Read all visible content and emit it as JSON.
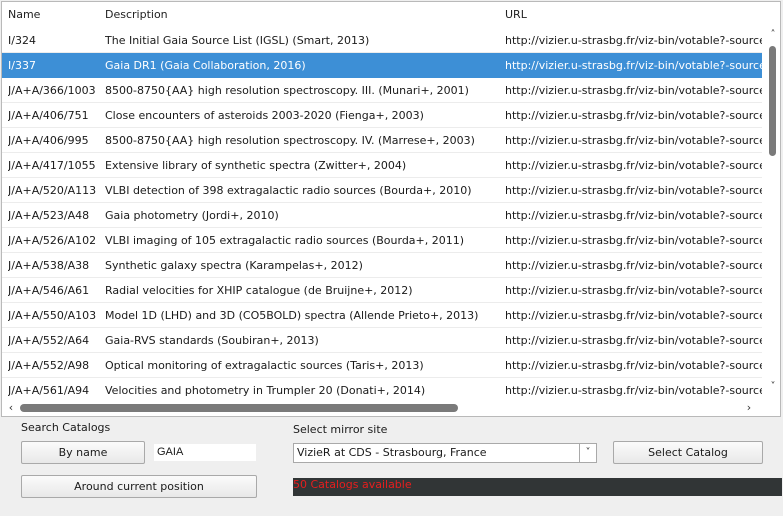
{
  "table": {
    "columns": {
      "name": "Name",
      "description": "Description",
      "url": "URL"
    },
    "rows": [
      {
        "name": "I/324",
        "description": "The Initial Gaia Source List (IGSL) (Smart, 2013)",
        "url": "http://vizier.u-strasbg.fr/viz-bin/votable?-source",
        "selected": false
      },
      {
        "name": "I/337",
        "description": "Gaia DR1 (Gaia Collaboration, 2016)",
        "url": "http://vizier.u-strasbg.fr/viz-bin/votable?-source",
        "selected": true
      },
      {
        "name": "J/A+A/366/1003",
        "description": "8500-8750{AA} high resolution spectroscopy. III. (Munari+, 2001)",
        "url": "http://vizier.u-strasbg.fr/viz-bin/votable?-source",
        "selected": false
      },
      {
        "name": "J/A+A/406/751",
        "description": "Close encounters of asteroids 2003-2020 (Fienga+, 2003)",
        "url": "http://vizier.u-strasbg.fr/viz-bin/votable?-source",
        "selected": false
      },
      {
        "name": "J/A+A/406/995",
        "description": "8500-8750{AA} high resolution spectroscopy. IV. (Marrese+, 2003)",
        "url": "http://vizier.u-strasbg.fr/viz-bin/votable?-source",
        "selected": false
      },
      {
        "name": "J/A+A/417/1055",
        "description": "Extensive library of synthetic spectra (Zwitter+, 2004)",
        "url": "http://vizier.u-strasbg.fr/viz-bin/votable?-source",
        "selected": false
      },
      {
        "name": "J/A+A/520/A113",
        "description": "VLBI detection of 398 extragalactic radio sources (Bourda+, 2010)",
        "url": "http://vizier.u-strasbg.fr/viz-bin/votable?-source",
        "selected": false
      },
      {
        "name": "J/A+A/523/A48",
        "description": "Gaia photometry (Jordi+, 2010)",
        "url": "http://vizier.u-strasbg.fr/viz-bin/votable?-source",
        "selected": false
      },
      {
        "name": "J/A+A/526/A102",
        "description": "VLBI imaging of 105 extragalactic radio sources (Bourda+, 2011)",
        "url": "http://vizier.u-strasbg.fr/viz-bin/votable?-source",
        "selected": false
      },
      {
        "name": "J/A+A/538/A38",
        "description": "Synthetic galaxy spectra (Karampelas+, 2012)",
        "url": "http://vizier.u-strasbg.fr/viz-bin/votable?-source",
        "selected": false
      },
      {
        "name": "J/A+A/546/A61",
        "description": "Radial velocities for XHIP catalogue (de Bruijne+, 2012)",
        "url": "http://vizier.u-strasbg.fr/viz-bin/votable?-source",
        "selected": false
      },
      {
        "name": "J/A+A/550/A103",
        "description": "Model 1D (LHD) and 3D (CO5BOLD) spectra (Allende Prieto+, 2013)",
        "url": "http://vizier.u-strasbg.fr/viz-bin/votable?-source",
        "selected": false
      },
      {
        "name": "J/A+A/552/A64",
        "description": "Gaia-RVS standards (Soubiran+, 2013)",
        "url": "http://vizier.u-strasbg.fr/viz-bin/votable?-source",
        "selected": false
      },
      {
        "name": "J/A+A/552/A98",
        "description": "Optical monitoring of extragalactic sources (Taris+, 2013)",
        "url": "http://vizier.u-strasbg.fr/viz-bin/votable?-source",
        "selected": false
      },
      {
        "name": "J/A+A/561/A94",
        "description": "Velocities and photometry in Trumpler 20 (Donati+, 2014)",
        "url": "http://vizier.u-strasbg.fr/viz-bin/votable?-source",
        "selected": false
      }
    ],
    "selected_color": "#3d8fd6"
  },
  "scrollbars": {
    "up_icon": "chevron-up-icon",
    "down_icon": "chevron-down-icon",
    "left_icon": "chevron-left-icon",
    "right_icon": "chevron-right-icon"
  },
  "search": {
    "label": "Search Catalogs",
    "by_name_button": "By name",
    "query_value": "GAIA",
    "around_position_button": "Around current position"
  },
  "mirror": {
    "label": "Select mirror site",
    "selected": "VizieR at CDS - Strasbourg, France",
    "arrow_icon": "chevron-down-icon"
  },
  "select_catalog_button": "Select Catalog",
  "status": {
    "text": "50 Catalogs available",
    "text_color": "#e61e1e",
    "background": "#313536"
  }
}
